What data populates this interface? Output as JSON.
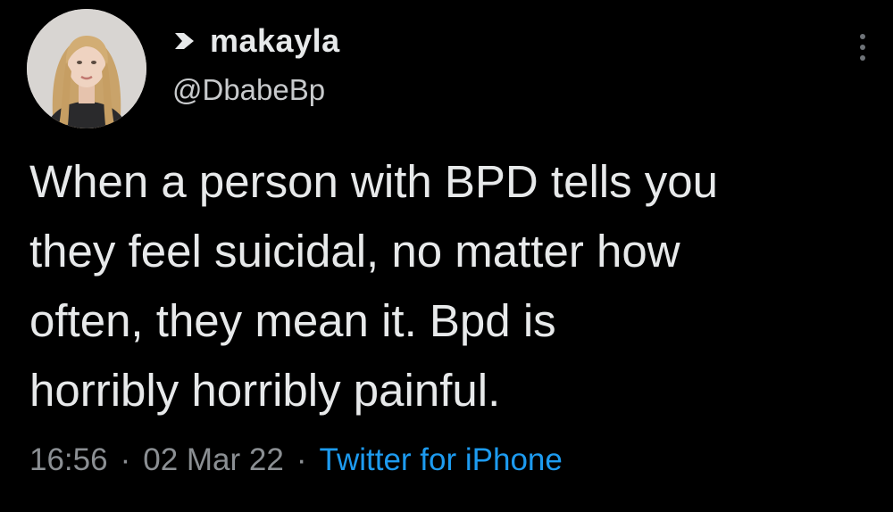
{
  "tweet": {
    "display_name": "makayla",
    "handle": "@DbabeBp",
    "text": "When a person with BPD tells you\nthey feel suicidal, no matter how\noften, they mean it. Bpd is\nhorribly horribly painful.",
    "time": "16:56",
    "date": "02 Mar 22",
    "source": "Twitter for iPhone",
    "separator": "·"
  },
  "icons": {
    "name_prefix": "heart-arrow-icon",
    "menu": "more-vertical-icon"
  },
  "colors": {
    "background": "#000000",
    "text": "#e7e9ea",
    "secondary": "#8b8f93",
    "link": "#1d9bf0"
  }
}
